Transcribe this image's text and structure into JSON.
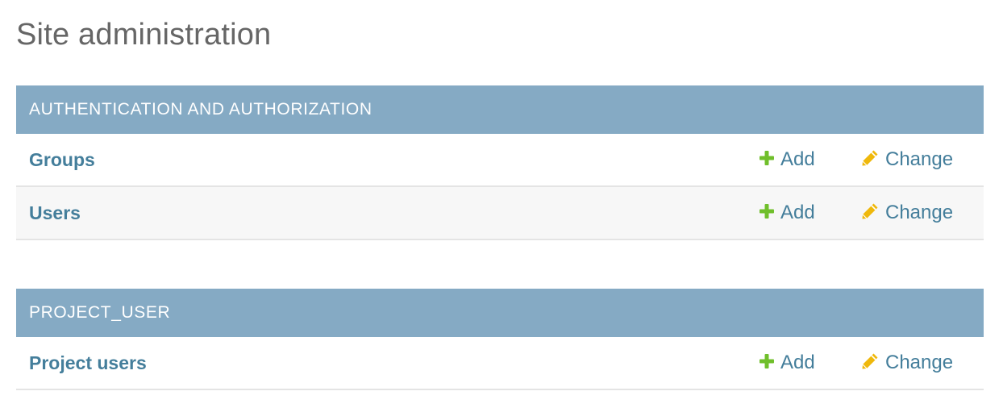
{
  "page": {
    "title": "Site administration"
  },
  "modules": [
    {
      "caption": "AUTHENTICATION AND AUTHORIZATION",
      "rows": [
        {
          "model": "Groups",
          "add_label": "Add",
          "change_label": "Change"
        },
        {
          "model": "Users",
          "add_label": "Add",
          "change_label": "Change"
        }
      ]
    },
    {
      "caption": "PROJECT_USER",
      "rows": [
        {
          "model": "Project users",
          "add_label": "Add",
          "change_label": "Change"
        }
      ]
    }
  ],
  "icons": {
    "add": "plus-icon",
    "change": "pencil-icon"
  },
  "colors": {
    "caption_bg": "#85aac4",
    "link": "#447e9b",
    "add_icon": "#70bf2b",
    "change_icon": "#efb80b"
  }
}
